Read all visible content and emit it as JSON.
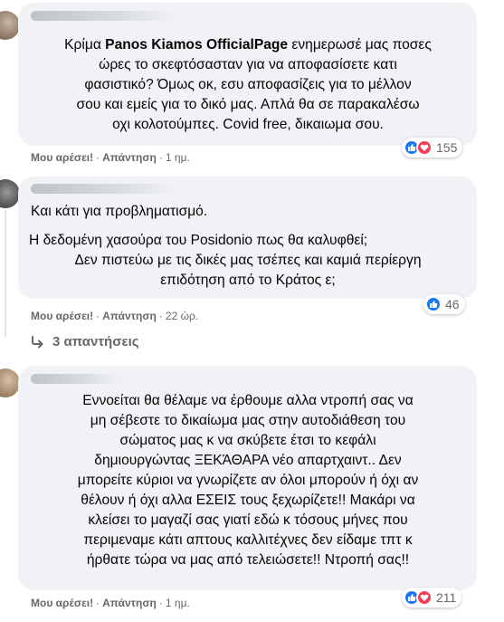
{
  "comments": [
    {
      "author": "",
      "text_parts": [
        {
          "before": "Κρίμα ",
          "bold": "Panos Kiamos OfficialPage",
          "after": " ενημερωσέ μας ποσες"
        },
        {
          "before": "ώρες το σκεφτόσασταν για να αποφασίσετε κατι",
          "bold": "",
          "after": ""
        },
        {
          "before": "φασιστικό? Όμως οκ, εσυ αποφασίζεις για το μέλλον",
          "bold": "",
          "after": ""
        },
        {
          "before": "σου και εμείς για το δικό μας. Απλά θα σε παρακαλέσω",
          "bold": "",
          "after": ""
        },
        {
          "before": "οχι κολοτούμπες. Covid free, δικαιωμα σου.",
          "bold": "",
          "after": ""
        }
      ],
      "like_label": "Μου αρέσει!",
      "reply_label": "Απάντηση",
      "separator": "·",
      "time": "1 ημ.",
      "reaction_count": "155"
    },
    {
      "author": "",
      "lines": [
        "Και κάτι για προβληματισμό.",
        "Η δεδομένη χασούρα του Posidonio πως θα καλυφθεί;",
        "Δεν πιστεύω με τις δικές μας τσέπες και καμιά περίεργη",
        "επιδότηση από το Κράτος ε;"
      ],
      "like_label": "Μου αρέσει!",
      "reply_label": "Απάντηση",
      "separator": "·",
      "time": "22 ώρ.",
      "reaction_count": "46",
      "replies_label": "3 απαντήσεις"
    },
    {
      "author": "",
      "lines": [
        "Εννοείται θα θέλαμε να έρθουμε αλλα ντροπή σας να",
        "μη σέβεστε το δικαίωμα μας στην αυτοδιάθεση του",
        "σώματος μας κ να σκύβετε έτσι το κεφάλι",
        "δημιουργώντας ΞΕΚΆΘΑΡΑ νέο απαρτχαιντ.. Δεν",
        "μπορείτε κύριοι να γνωρίζετε αν όλοι μπορούν ή όχι αν",
        "θέλουν ή όχι αλλα ΕΣΕΙΣ τους ξεχωρίζετε!! Μακάρι να",
        "κλείσει το μαγαζί σας γιατί εδώ κ τόσους μήνες που",
        "περιμεναμε κάτι απτους καλλιτέχνες δεν είδαμε τπτ κ",
        "ήρθατε τώρα να μας από τελειώσετε!! Ντροπή σας!!"
      ],
      "like_label": "Μου αρέσει!",
      "reply_label": "Απάντηση",
      "separator": "·",
      "time": "1 ημ.",
      "reaction_count": "211"
    }
  ],
  "colors": {
    "like": "#1877f2",
    "love": "#f33e58",
    "bubble": "#f0f2f5",
    "meta": "#65676b"
  },
  "icons": {
    "like": "like-reaction-icon",
    "love": "love-reaction-icon",
    "reply_arrow": "reply-arrow-icon"
  }
}
